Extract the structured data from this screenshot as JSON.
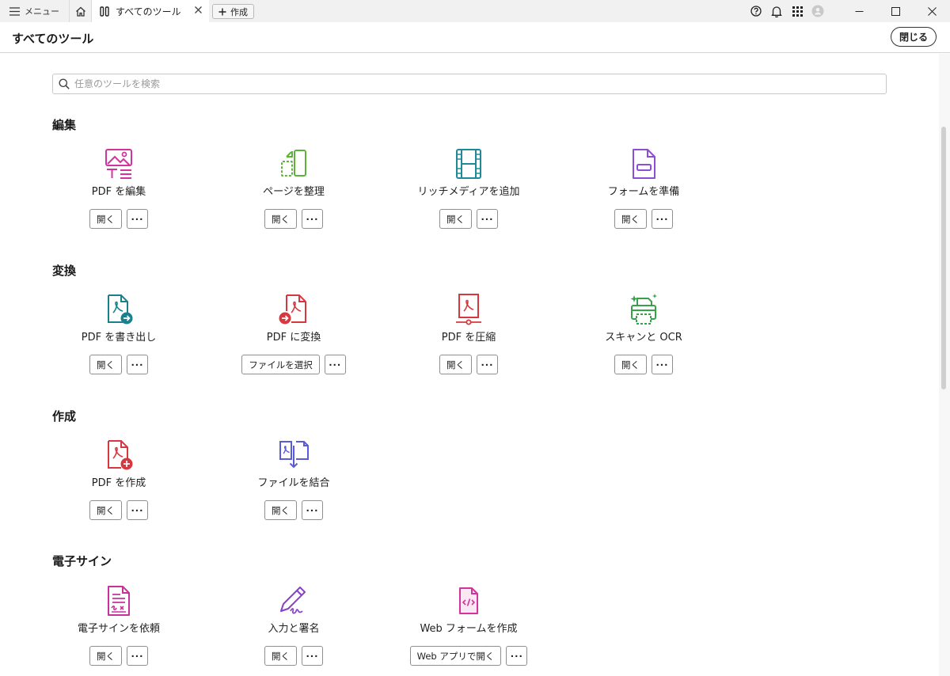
{
  "titlebar": {
    "menu_label": "メニュー",
    "tab_label": "すべてのツール",
    "new_label": "作成"
  },
  "header": {
    "title": "すべてのツール",
    "close_label": "閉じる"
  },
  "search": {
    "placeholder": "任意のツールを検索"
  },
  "sections": [
    {
      "title": "編集",
      "tools": [
        {
          "label": "PDF を編集",
          "action": "開く"
        },
        {
          "label": "ページを整理",
          "action": "開く"
        },
        {
          "label": "リッチメディアを追加",
          "action": "開く"
        },
        {
          "label": "フォームを準備",
          "action": "開く"
        }
      ]
    },
    {
      "title": "変換",
      "tools": [
        {
          "label": "PDF を書き出し",
          "action": "開く"
        },
        {
          "label": "PDF に変換",
          "action": "ファイルを選択"
        },
        {
          "label": "PDF を圧縮",
          "action": "開く"
        },
        {
          "label": "スキャンと OCR",
          "action": "開く"
        }
      ]
    },
    {
      "title": "作成",
      "tools": [
        {
          "label": "PDF を作成",
          "action": "開く"
        },
        {
          "label": "ファイルを結合",
          "action": "開く"
        }
      ]
    },
    {
      "title": "電子サイン",
      "tools": [
        {
          "label": "電子サインを依頼",
          "action": "開く"
        },
        {
          "label": "入力と署名",
          "action": "開く"
        },
        {
          "label": "Web フォームを作成",
          "action": "Web アプリで開く"
        }
      ]
    }
  ],
  "more_label": "···",
  "colors": {
    "edit_pink": "#d1359b",
    "organize_green": "#5cb338",
    "media_teal": "#1e8a99",
    "form_purple": "#8a4fd6",
    "export_teal": "#1a7f8e",
    "convert_red": "#d7373f",
    "scan_green": "#37a24a",
    "combine_blue": "#5a5cd6"
  }
}
